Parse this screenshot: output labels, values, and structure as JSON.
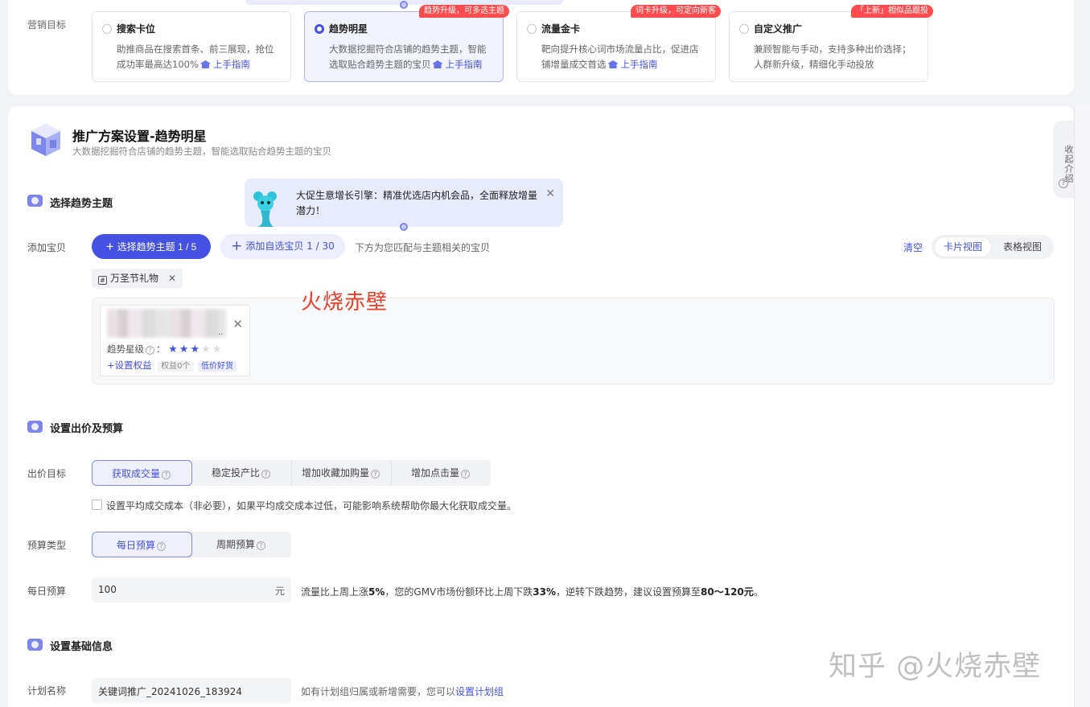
{
  "marketing_goal": {
    "label": "营销目标",
    "cards": [
      {
        "title": "搜索卡位",
        "desc": "助推商品在搜索首条、前三展现，抢位成功率最高达100%",
        "guide": "上手指南",
        "selected": false,
        "badge": ""
      },
      {
        "title": "趋势明星",
        "desc": "大数据挖掘符合店铺的趋势主题，智能选取贴合趋势主题的宝贝",
        "guide": "上手指南",
        "selected": true,
        "badge": "趋势升级，可多选主题"
      },
      {
        "title": "流量金卡",
        "desc": "靶向提升核心词市场流量占比，促进店铺增量成交首选",
        "guide": "上手指南",
        "selected": false,
        "badge": "词卡升级，可定向新客"
      },
      {
        "title": "自定义推广",
        "desc": "兼顾智能与手动，支持多种出价选择；人群新升级，精细化手动投放",
        "guide": "",
        "selected": false,
        "badge": "「上新」相似品跟投"
      }
    ]
  },
  "plan": {
    "title": "推广方案设置-趋势明星",
    "subtitle": "大数据挖掘符合店铺的趋势主题，智能选取贴合趋势主题的宝贝"
  },
  "collapse_tab": {
    "label": "收起介绍",
    "icon": "question-icon"
  },
  "section_theme": {
    "title": "选择趋势主题"
  },
  "tip": {
    "text": "大促生意增长引擎：精准优选店内机会品，全面释放增量潜力！",
    "close": "✕"
  },
  "add_items": {
    "label": "添加宝贝",
    "select_theme_btn": "选择趋势主题 1 / 5",
    "add_custom_btn": "添加自选宝贝 1 / 30",
    "hint": "下方为您匹配与主题相关的宝贝",
    "clear": "清空",
    "view_card": "卡片视图",
    "view_table": "表格视图",
    "tag": "万圣节礼物"
  },
  "watermark_red": "火烧赤壁",
  "item_card": {
    "title_dots": "..",
    "star_label": "趋势星级",
    "stars": 3,
    "stars_total": 5,
    "set_benefit": "+设置权益",
    "benefit_count": "权益0个",
    "cheap_tag": "低价好货"
  },
  "section_bid": {
    "title": "设置出价及预算"
  },
  "bid_target": {
    "label": "出价目标",
    "options": [
      "获取成交量",
      "稳定投产比",
      "增加收藏加购量",
      "增加点击量"
    ],
    "selected": 0,
    "checkbox_label": "设置平均成交成本（非必要），如果平均成交成本过低，可能影响系统帮助你最大化获取成交量。"
  },
  "budget_type": {
    "label": "预算类型",
    "options": [
      "每日预算",
      "周期预算"
    ],
    "selected": 0
  },
  "daily_budget": {
    "label": "每日预算",
    "value": "100",
    "unit": "元",
    "hint_prefix": "流量比上周上涨",
    "hint_up": "5%",
    "hint_mid": "，您的GMV市场份额环比上周下跌",
    "hint_down": "33%",
    "hint_mid2": "，逆转下跌趋势，建议设置预算至",
    "hint_range": "80～120元",
    "hint_end": "。"
  },
  "section_basic": {
    "title": "设置基础信息"
  },
  "plan_name": {
    "label": "计划名称",
    "value": "关键词推广_20241026_183924",
    "hint_prefix": "如有计划组归属或新增需要，您可以",
    "hint_link": "设置计划组"
  },
  "zhihu_watermark": "知乎 @火烧赤壁",
  "colors": {
    "accent": "#4451e3",
    "badge": "#ff4d4f"
  }
}
